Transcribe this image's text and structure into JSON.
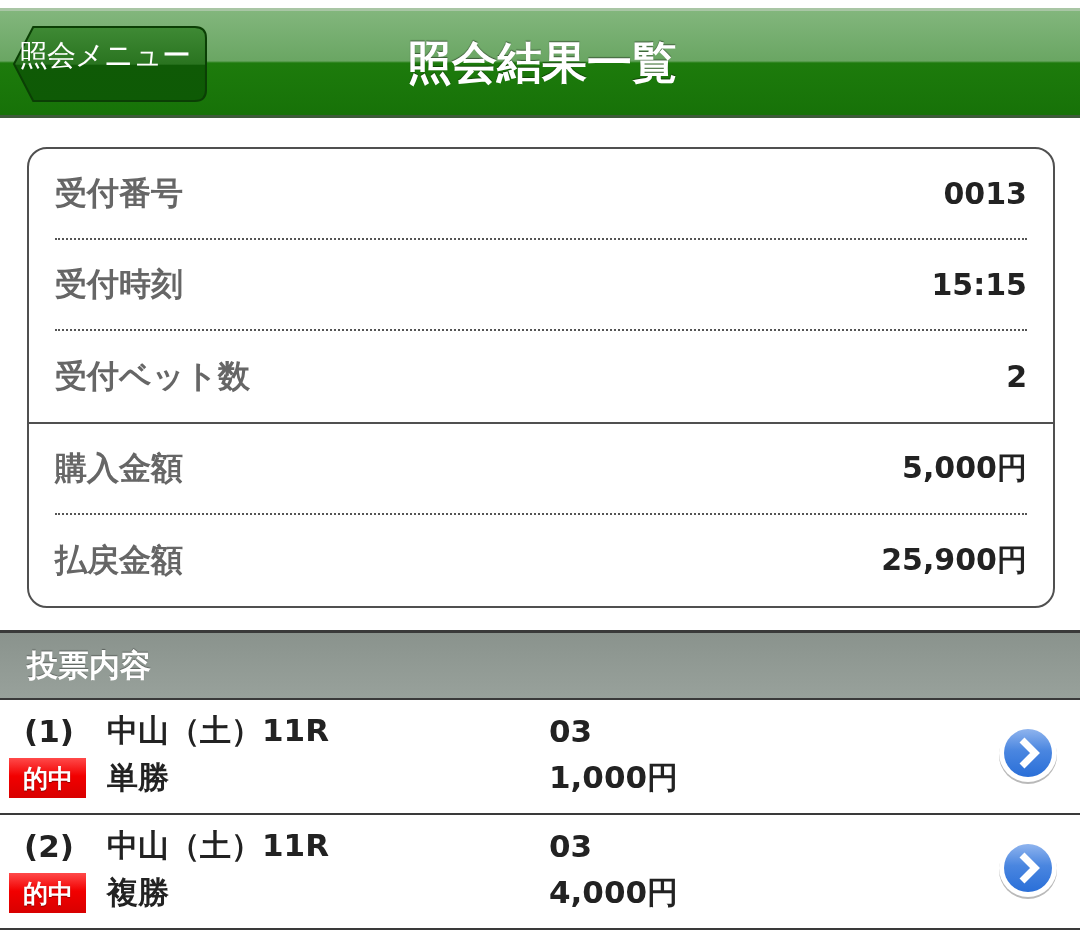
{
  "header": {
    "back_button": "照会メニュー",
    "title": "照会結果一覧"
  },
  "summary": [
    {
      "rows": [
        {
          "label": "受付番号",
          "value": "0013"
        },
        {
          "label": "受付時刻",
          "value": "15:15"
        },
        {
          "label": "受付ベット数",
          "value": "2"
        }
      ]
    },
    {
      "rows": [
        {
          "label": "購入金額",
          "value": "5,000円"
        },
        {
          "label": "払戻金額",
          "value": "25,900円"
        }
      ]
    }
  ],
  "bets": {
    "title": "投票内容",
    "items": [
      {
        "number": "(1)",
        "race": "中山（土）11R",
        "selection": "03",
        "badge": "的中",
        "bet_type": "単勝",
        "amount": "1,000円"
      },
      {
        "number": "(2)",
        "race": "中山（土）11R",
        "selection": "03",
        "badge": "的中",
        "bet_type": "複勝",
        "amount": "4,000円"
      }
    ]
  }
}
